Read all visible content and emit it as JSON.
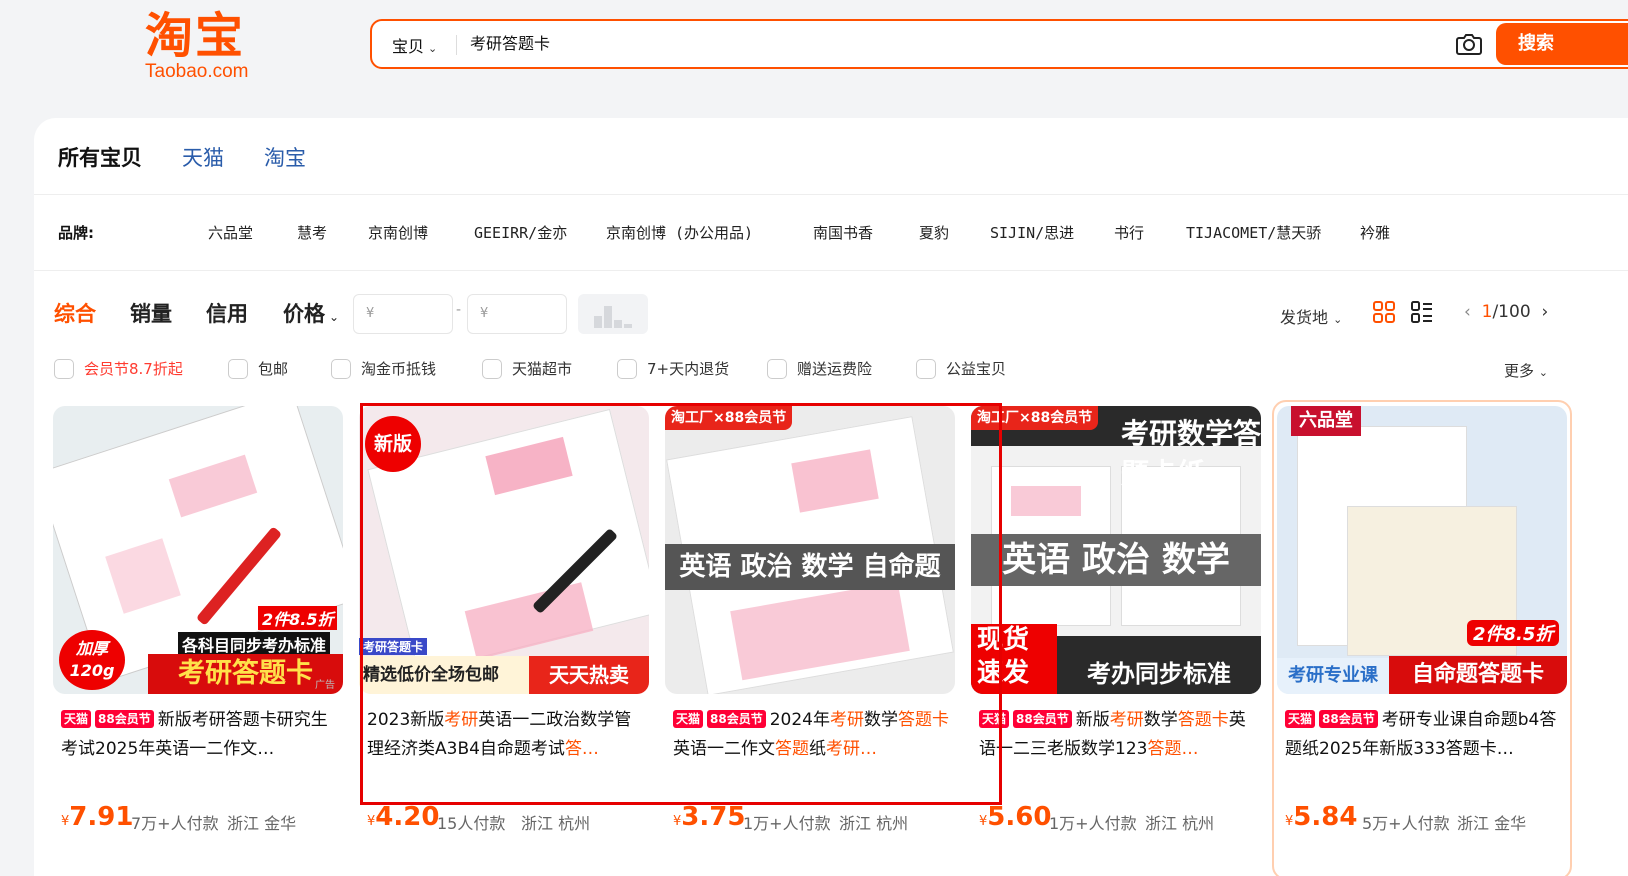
{
  "logo": {
    "zh": "淘宝",
    "en": "Taobao.com"
  },
  "search": {
    "category": "宝贝",
    "query": "考研答题卡",
    "button": "搜索"
  },
  "tabs": [
    "所有宝贝",
    "天猫",
    "淘宝"
  ],
  "brands": {
    "label": "品牌:",
    "items": [
      "六品堂",
      "慧考",
      "京南创博",
      "GEEIRR/金亦",
      "京南创博 (办公用品)",
      "南国书香",
      "夏豹",
      "SIJIN/思进",
      "书行",
      "TIJACOMET/慧天骄",
      "衿雅"
    ]
  },
  "sort": {
    "items": [
      "综合",
      "销量",
      "信用",
      "价格"
    ],
    "price_min_placeholder": "¥",
    "price_max_placeholder": "¥",
    "dash": "-",
    "ship_from": "发货地",
    "page_current": "1",
    "page_total": "/100"
  },
  "filters": [
    "会员节8.7折起",
    "包邮",
    "淘金币抵钱",
    "天猫超市",
    "7+天内退货",
    "赠送运费险",
    "公益宝贝"
  ],
  "more": "更多",
  "products": [
    {
      "tags": [
        "天猫",
        "88会员节"
      ],
      "title_parts": [
        {
          "t": "新版考研答题卡研究生考试2025年英语一二作文…",
          "h": false
        }
      ],
      "currency": "¥",
      "price": "7.91",
      "sales": "7万+人付款",
      "location": "浙江 金华",
      "img_texts": {
        "badge_left": "加厚\n120g",
        "promo": "2件8.5折",
        "sub": "各科目同步考办标准",
        "main": "考研答题卡",
        "ad": "广告"
      }
    },
    {
      "tags": [],
      "title_parts": [
        {
          "t": "2023新版",
          "h": false
        },
        {
          "t": "考研",
          "h": true
        },
        {
          "t": "英语一二政治数学管理经济类A3B4自命题考试",
          "h": false
        },
        {
          "t": "答…",
          "h": true
        }
      ],
      "currency": "¥",
      "price": "4.20",
      "sales": "15人付款",
      "location": "浙江 杭州",
      "img_texts": {
        "badge_left": "新版",
        "corner": "考研答题卡",
        "bottom_left": "精选低价全场包邮",
        "bottom_right": "天天热卖"
      }
    },
    {
      "tags": [
        "天猫",
        "88会员节"
      ],
      "title_parts": [
        {
          "t": "2024年",
          "h": false
        },
        {
          "t": "考研",
          "h": true
        },
        {
          "t": "数学",
          "h": false
        },
        {
          "t": "答题卡",
          "h": true
        },
        {
          "t": "英语一二作文",
          "h": false
        },
        {
          "t": "答题",
          "h": true
        },
        {
          "t": "纸",
          "h": false
        },
        {
          "t": "考研…",
          "h": true
        }
      ],
      "currency": "¥",
      "price": "3.75",
      "sales": "1万+人付款",
      "location": "浙江 杭州",
      "img_texts": {
        "top": "淘工厂×88会员节",
        "middle": "英语 政治 数学 自命题"
      }
    },
    {
      "tags": [
        "天猫",
        "88会员节"
      ],
      "title_parts": [
        {
          "t": "新版",
          "h": false
        },
        {
          "t": "考研",
          "h": true
        },
        {
          "t": "数学",
          "h": false
        },
        {
          "t": "答题卡",
          "h": true
        },
        {
          "t": "英语一二三老版数学123",
          "h": false
        },
        {
          "t": "答题…",
          "h": true
        }
      ],
      "currency": "¥",
      "price": "5.60",
      "sales": "1万+人付款",
      "location": "浙江 杭州",
      "img_texts": {
        "top": "淘工厂×88会员节",
        "top_title": "考研数学答题卡纸",
        "middle": "英语 政治 数学",
        "bottom_left": "现货\n速发",
        "bottom_right": "考办同步标准"
      }
    },
    {
      "tags": [
        "天猫",
        "88会员节"
      ],
      "title_parts": [
        {
          "t": "考研专业课自命题b4答题纸2025年新版333答题卡…",
          "h": false
        }
      ],
      "currency": "¥",
      "price": "5.84",
      "sales": "5万+人付款",
      "location": "浙江 金华",
      "img_texts": {
        "logo": "六品堂",
        "promo": "2件8.5折",
        "bottom_left": "考研专业课",
        "bottom_right": "自命题答题卡"
      }
    }
  ],
  "colors": {
    "accent": "#ff5000",
    "tag_red": "#ff0036",
    "link_blue": "#2a5caa",
    "selection": "#e60000"
  }
}
